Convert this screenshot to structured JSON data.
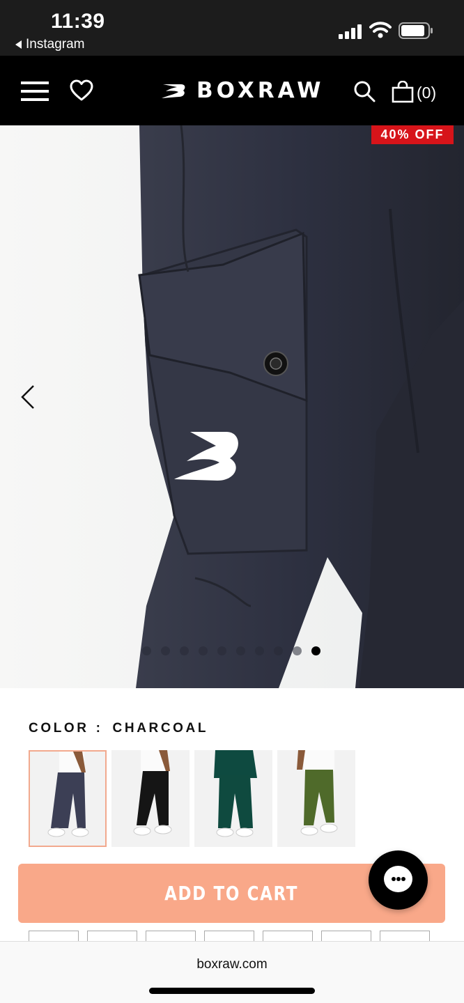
{
  "status_bar": {
    "time": "11:39",
    "back_app": "Instagram",
    "icons": [
      "signal-icon",
      "wifi-icon",
      "battery-icon"
    ]
  },
  "header": {
    "brand": "BOXRAW",
    "cart_count": "(0)",
    "icons": [
      "menu-icon",
      "heart-icon",
      "search-icon",
      "bag-icon"
    ],
    "background": "#000000"
  },
  "product_image": {
    "badge": "40% OFF",
    "badge_color": "#d7141a",
    "total_images": 10,
    "active_image": 10
  },
  "color": {
    "label": "COLOR",
    "separator": ":",
    "selected": "CHARCOAL",
    "swatch_count": 4,
    "selected_index": 0
  },
  "cart": {
    "button_label": "ADD TO CART",
    "button_color": "#f9a889"
  },
  "browser": {
    "url": "boxraw.com"
  }
}
